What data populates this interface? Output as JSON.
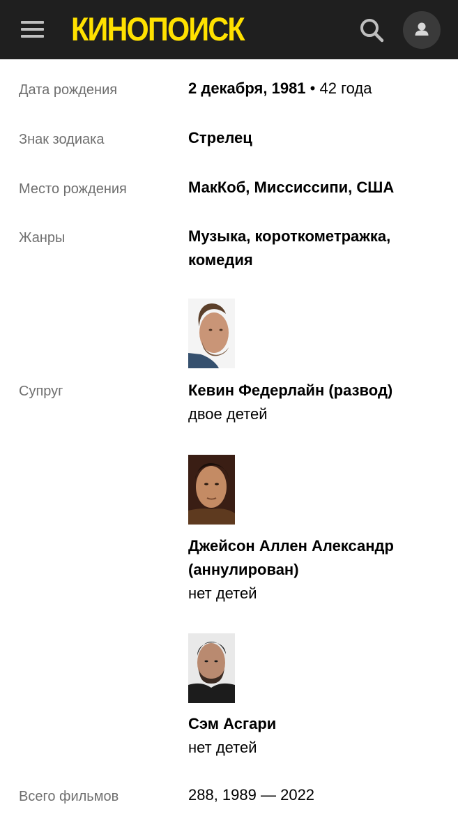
{
  "header": {
    "logo_text": "КИНОПОИСК",
    "menu_icon": "hamburger-menu-icon",
    "search_icon": "search-icon",
    "profile_icon": "user-icon",
    "logo_color": "#ffe100",
    "bar_color": "#1f1f1f"
  },
  "info": {
    "birth_date": {
      "label": "Дата рождения",
      "date": "2 декабря, 1981",
      "separator": " • ",
      "age": "42 года"
    },
    "zodiac": {
      "label": "Знак зодиака",
      "value": "Стрелец"
    },
    "birthplace": {
      "label": "Место рождения",
      "value": "МакКоб, Миссиссипи, США"
    },
    "genres": {
      "label": "Жанры",
      "value": "Музыка, короткометражка, комедия"
    },
    "spouses": {
      "label": "Супруг",
      "items": [
        {
          "name": "Кевин Федерлайн (развод)",
          "note": "двое детей"
        },
        {
          "name": "Джейсон Аллен Александр (аннулирован)",
          "note": "нет детей"
        },
        {
          "name": "Сэм Асгари",
          "note": "нет детей"
        }
      ]
    },
    "total_films": {
      "label": "Всего фильмов",
      "value": "288, 1989 — 2022"
    }
  }
}
